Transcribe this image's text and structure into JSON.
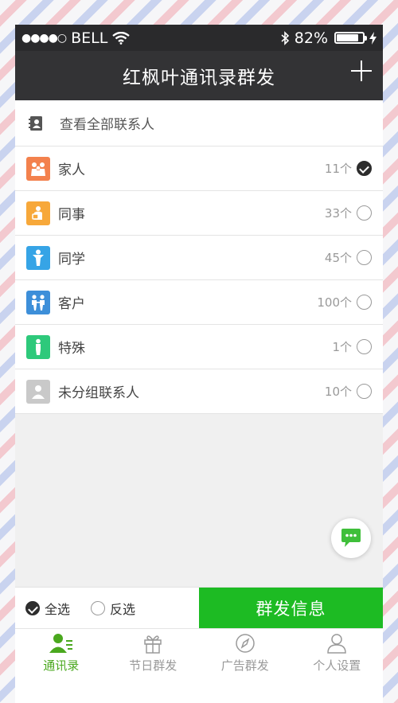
{
  "status_bar": {
    "signal": "●●●●○",
    "carrier": "BELL",
    "battery": "82%"
  },
  "navbar": {
    "title": "红枫叶通讯录群发"
  },
  "header_row": {
    "label": "查看全部联系人"
  },
  "groups": [
    {
      "name": "家人",
      "count": "11个",
      "checked": true,
      "color": "#f3814d",
      "icon": "family-icon"
    },
    {
      "name": "同事",
      "count": "33个",
      "checked": false,
      "color": "#f7a83a",
      "icon": "colleague-icon"
    },
    {
      "name": "同学",
      "count": "45个",
      "checked": false,
      "color": "#36a4e6",
      "icon": "classmate-icon"
    },
    {
      "name": "客户",
      "count": "100个",
      "checked": false,
      "color": "#3d8fd9",
      "icon": "customer-icon"
    },
    {
      "name": "特殊",
      "count": "1个",
      "checked": false,
      "color": "#2ec97b",
      "icon": "special-icon"
    },
    {
      "name": "未分组联系人",
      "count": "10个",
      "checked": false,
      "color": "#c9c9c9",
      "icon": "person-icon"
    }
  ],
  "actions": {
    "select_all": "全选",
    "invert": "反选",
    "send": "群发信息"
  },
  "tabs": [
    {
      "label": "通讯录",
      "icon": "contacts-icon"
    },
    {
      "label": "节日群发",
      "icon": "gift-icon"
    },
    {
      "label": "广告群发",
      "icon": "compass-icon"
    },
    {
      "label": "个人设置",
      "icon": "user-icon"
    }
  ],
  "colors": {
    "accent": "#1dbb23",
    "tab_active": "#4aa81e",
    "navbar": "#333335"
  }
}
